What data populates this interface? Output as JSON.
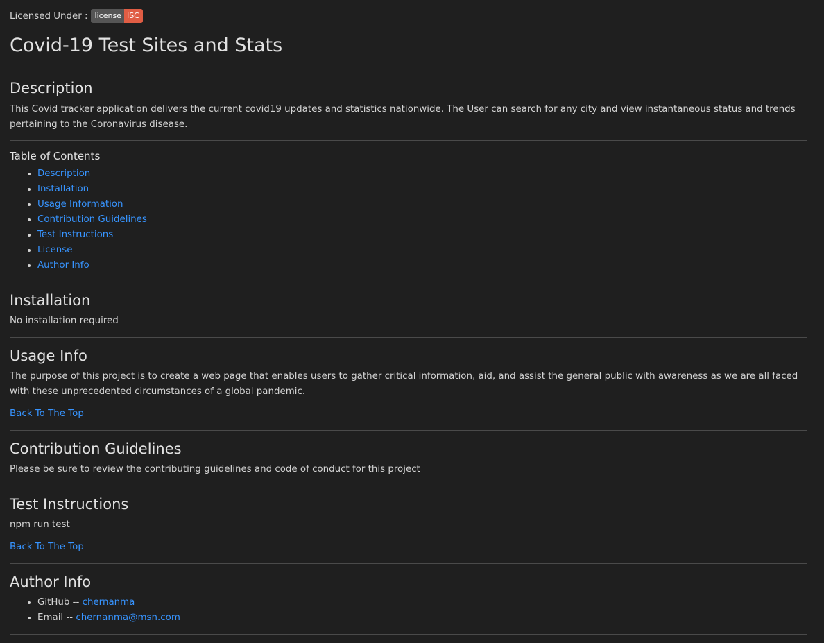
{
  "license": {
    "prefix": "Licensed Under :",
    "badge_left": "license",
    "badge_right": "ISC"
  },
  "title": "Covid-19 Test Sites and Stats",
  "sections": {
    "description": {
      "heading": "Description",
      "text": "This Covid tracker application delivers the current covid19 updates and statistics nationwide. The User can search for any city and view instantaneous status and trends pertaining to the Coronavirus disease."
    },
    "toc": {
      "heading": "Table of Contents",
      "items": [
        "Description",
        "Installation",
        "Usage Information",
        "Contribution Guidelines",
        "Test Instructions",
        "License",
        "Author Info"
      ]
    },
    "installation": {
      "heading": "Installation",
      "text": "No installation required"
    },
    "usage": {
      "heading": "Usage Info",
      "text": "The purpose of this project is to create a web page that enables users to gather critical information, aid, and assist the general public with awareness as we are all faced with these unprecedented circumstances of a global pandemic.",
      "back_link": "Back To The Top"
    },
    "contribution": {
      "heading": "Contribution Guidelines",
      "text": "Please be sure to review the contributing guidelines and code of conduct for this project"
    },
    "tests": {
      "heading": "Test Instructions",
      "text": "npm run test",
      "back_link": "Back To The Top"
    },
    "author": {
      "heading": "Author Info",
      "github_label": "GitHub -- ",
      "github_link": "chernanma",
      "email_label": "Email -- ",
      "email_link": "chernanma@msn.com"
    }
  },
  "colors": {
    "background": "#1f1f1f",
    "text": "#d4d4d4",
    "link": "#3794ff",
    "badge_left": "#555555",
    "badge_right": "#e05d44",
    "rule": "#4a4a4a"
  }
}
